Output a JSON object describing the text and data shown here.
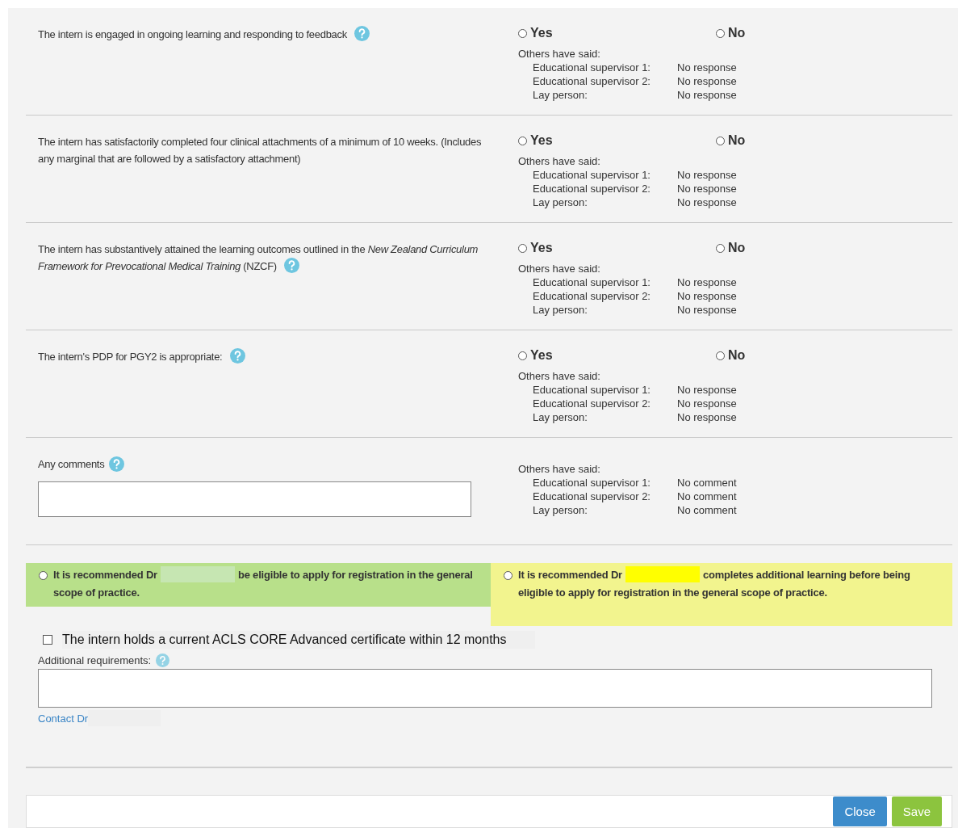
{
  "questions": [
    {
      "text": "The intern is engaged in ongoing learning and responding to feedback",
      "help": true,
      "options": [
        {
          "label": "Yes",
          "selected": false
        },
        {
          "label": "No",
          "selected": false
        }
      ],
      "others_heading": "Others have said:",
      "others": [
        {
          "role": "Educational supervisor 1:",
          "answer": "No response"
        },
        {
          "role": "Educational supervisor 2:",
          "answer": "No response"
        },
        {
          "role": "Lay person:",
          "answer": "No response"
        }
      ]
    },
    {
      "text": "The intern has satisfactorily completed four clinical attachments of a minimum of 10 weeks. (Includes any marginal that are followed by a satisfactory attachment)",
      "help": false,
      "options": [
        {
          "label": "Yes",
          "selected": false
        },
        {
          "label": "No",
          "selected": false
        }
      ],
      "others_heading": "Others have said:",
      "others": [
        {
          "role": "Educational supervisor 1:",
          "answer": "No response"
        },
        {
          "role": "Educational supervisor 2:",
          "answer": "No response"
        },
        {
          "role": "Lay person:",
          "answer": "No response"
        }
      ]
    },
    {
      "text": "The intern has substantively attained the learning outcomes outlined in the *New Zealand Curriculum Framework for Prevocational Medical Training* (NZCF)",
      "help": true,
      "options": [
        {
          "label": "Yes",
          "selected": false
        },
        {
          "label": "No",
          "selected": false
        }
      ],
      "others_heading": "Others have said:",
      "others": [
        {
          "role": "Educational supervisor 1:",
          "answer": "No response"
        },
        {
          "role": "Educational supervisor 2:",
          "answer": "No response"
        },
        {
          "role": "Lay person:",
          "answer": "No response"
        }
      ]
    },
    {
      "text": "The intern's PDP for PGY2 is appropriate:",
      "help": true,
      "options": [
        {
          "label": "Yes",
          "selected": false
        },
        {
          "label": "No",
          "selected": false
        }
      ],
      "others_heading": "Others have said:",
      "others": [
        {
          "role": "Educational supervisor 1:",
          "answer": "No response"
        },
        {
          "role": "Educational supervisor 2:",
          "answer": "No response"
        },
        {
          "role": "Lay person:",
          "answer": "No response"
        }
      ]
    }
  ],
  "comments": {
    "label": "Any comments",
    "others_heading": "Others have said:",
    "others": [
      {
        "role": "Educational supervisor 1:",
        "answer": "No comment"
      },
      {
        "role": "Educational supervisor 2:",
        "answer": "No comment"
      },
      {
        "role": "Lay person:",
        "answer": "No comment"
      }
    ]
  },
  "recommendations": [
    {
      "before": "It is recommended Dr",
      "after": "be eligible to apply for registration in the general scope of practice.",
      "selected": false,
      "color": "#b8e08a"
    },
    {
      "before": "It is recommended Dr",
      "after": "completes additional learning before being eligible to apply for registration in the general scope of practice.",
      "selected": false,
      "color": "#f2f48e"
    }
  ],
  "certificate": {
    "label": "The intern holds a current ACLS CORE Advanced certificate within 12 months",
    "checked": false
  },
  "additional": {
    "label": "Additional requirements:"
  },
  "contact_link": "Contact Dr",
  "buttons": [
    {
      "label": "Close",
      "kind": "close"
    },
    {
      "label": "Save",
      "kind": "save"
    }
  ]
}
